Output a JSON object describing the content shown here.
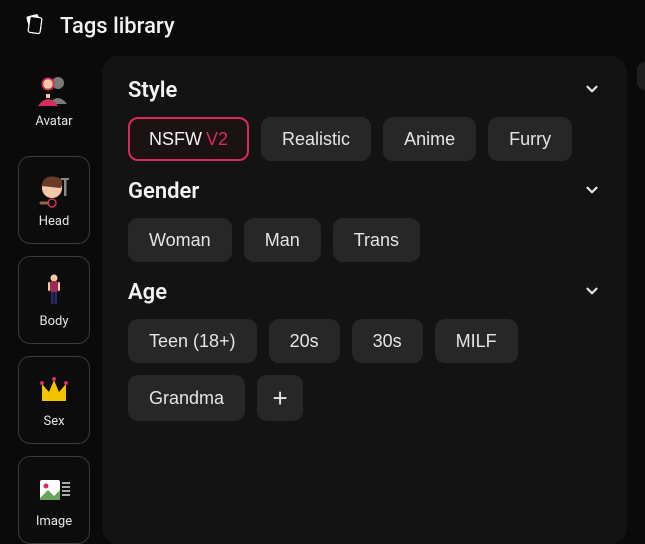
{
  "header": {
    "title": "Tags library"
  },
  "sidebar": {
    "items": [
      {
        "label": "Avatar"
      },
      {
        "label": "Head"
      },
      {
        "label": "Body"
      },
      {
        "label": "Sex"
      },
      {
        "label": "Image"
      }
    ]
  },
  "groups": {
    "style": {
      "title": "Style",
      "tags": [
        {
          "label": "NSFW",
          "suffix": "V2",
          "suffix_color": "#d72c5b",
          "selected": true
        },
        {
          "label": "Realistic",
          "selected": false
        },
        {
          "label": "Anime",
          "selected": false
        },
        {
          "label": "Furry",
          "selected": false
        }
      ]
    },
    "gender": {
      "title": "Gender",
      "tags": [
        {
          "label": "Woman"
        },
        {
          "label": "Man"
        },
        {
          "label": "Trans"
        }
      ]
    },
    "age": {
      "title": "Age",
      "tags": [
        {
          "label": "Teen (18+)"
        },
        {
          "label": "20s"
        },
        {
          "label": "30s"
        },
        {
          "label": "MILF"
        },
        {
          "label": "Grandma"
        }
      ],
      "has_more": true
    }
  },
  "colors": {
    "accent": "#d72c5b",
    "chip_bg": "#272727",
    "panel_bg": "#131313"
  }
}
